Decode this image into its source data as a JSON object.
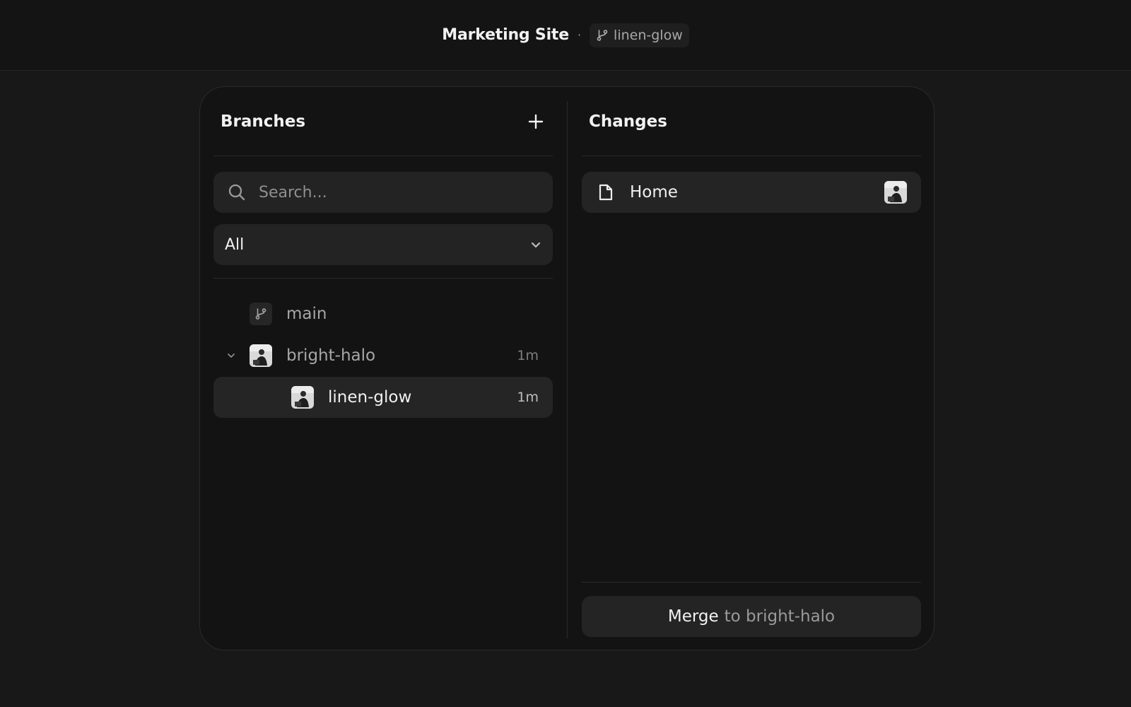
{
  "header": {
    "project_title": "Marketing Site",
    "separator": "·",
    "current_branch": "linen-glow"
  },
  "branches_panel": {
    "title": "Branches",
    "add_icon": "plus-icon",
    "search": {
      "placeholder": "Search...",
      "value": ""
    },
    "filter": {
      "selected": "All",
      "icon": "chevron-down-icon"
    },
    "items": [
      {
        "name": "main",
        "time": "",
        "icon": "git-branch-icon",
        "expanded": false,
        "selected": false,
        "level": 0
      },
      {
        "name": "bright-halo",
        "time": "1m",
        "icon": "avatar",
        "expanded": true,
        "selected": false,
        "level": 0
      },
      {
        "name": "linen-glow",
        "time": "1m",
        "icon": "avatar",
        "expanded": false,
        "selected": true,
        "level": 1
      }
    ]
  },
  "changes_panel": {
    "title": "Changes",
    "items": [
      {
        "name": "Home",
        "icon": "file-icon",
        "author_icon": "avatar"
      }
    ],
    "merge_button": {
      "action": "Merge",
      "target_text": "to bright-halo"
    }
  }
}
